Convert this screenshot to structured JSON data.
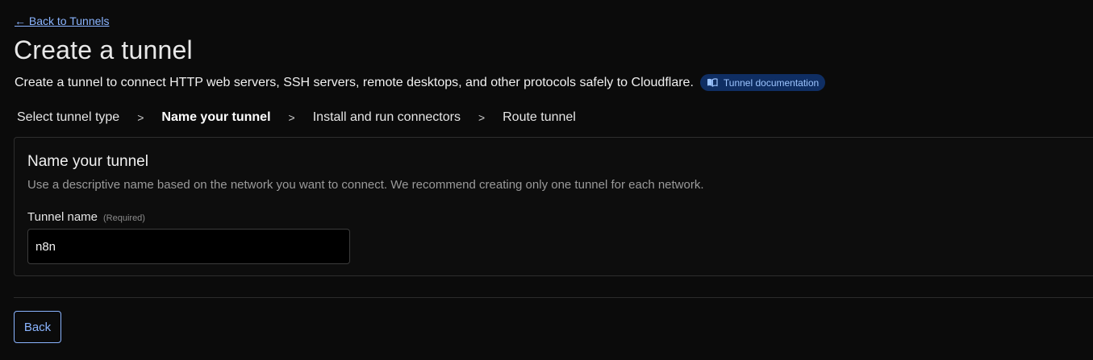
{
  "nav": {
    "back_link": "← Back to Tunnels"
  },
  "header": {
    "title": "Create a tunnel",
    "subtitle": "Create a tunnel to connect HTTP web servers, SSH servers, remote desktops, and other protocols safely to Cloudflare.",
    "doc_badge": {
      "label": "Tunnel documentation",
      "icon": "book-icon"
    }
  },
  "steps": [
    {
      "label": "Select tunnel type",
      "active": false
    },
    {
      "label": "Name your tunnel",
      "active": true
    },
    {
      "label": "Install and run connectors",
      "active": false
    },
    {
      "label": "Route tunnel",
      "active": false
    }
  ],
  "step_separator": ">",
  "card": {
    "title": "Name your tunnel",
    "description": "Use a descriptive name based on the network you want to connect. We recommend creating only one tunnel for each network.",
    "field": {
      "label": "Tunnel name",
      "required_text": "(Required)",
      "value": "n8n"
    }
  },
  "footer": {
    "back_button": "Back"
  },
  "colors": {
    "accent": "#8ab4ff",
    "background": "#0b0b0b",
    "badge_bg": "#0f2e63"
  }
}
